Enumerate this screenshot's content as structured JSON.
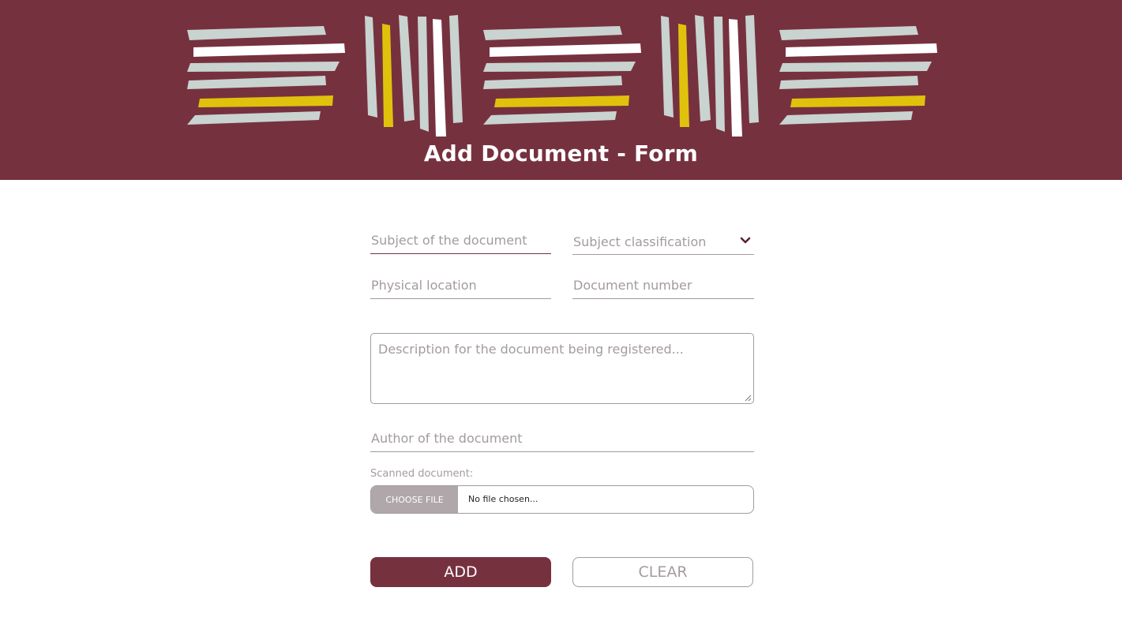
{
  "header": {
    "title": "Add Document - Form",
    "background_color": "#76313f",
    "stripe_colors": [
      "#c9d3d0",
      "#ffffff",
      "#e0c20d"
    ]
  },
  "form": {
    "subject": {
      "placeholder": "Subject of the document",
      "value": ""
    },
    "classification": {
      "label": "Subject classification",
      "icon": "chevron-down-icon"
    },
    "location": {
      "placeholder": "Physical location",
      "value": ""
    },
    "number": {
      "placeholder": "Document number",
      "value": ""
    },
    "description": {
      "placeholder": "Description for the document being registered...",
      "value": ""
    },
    "author": {
      "placeholder": "Author of the document",
      "value": ""
    },
    "scanned": {
      "label": "Scanned document:",
      "button_label": "CHOOSE FILE",
      "status": "No file chosen..."
    },
    "add_label": "ADD",
    "clear_label": "CLEAR"
  }
}
